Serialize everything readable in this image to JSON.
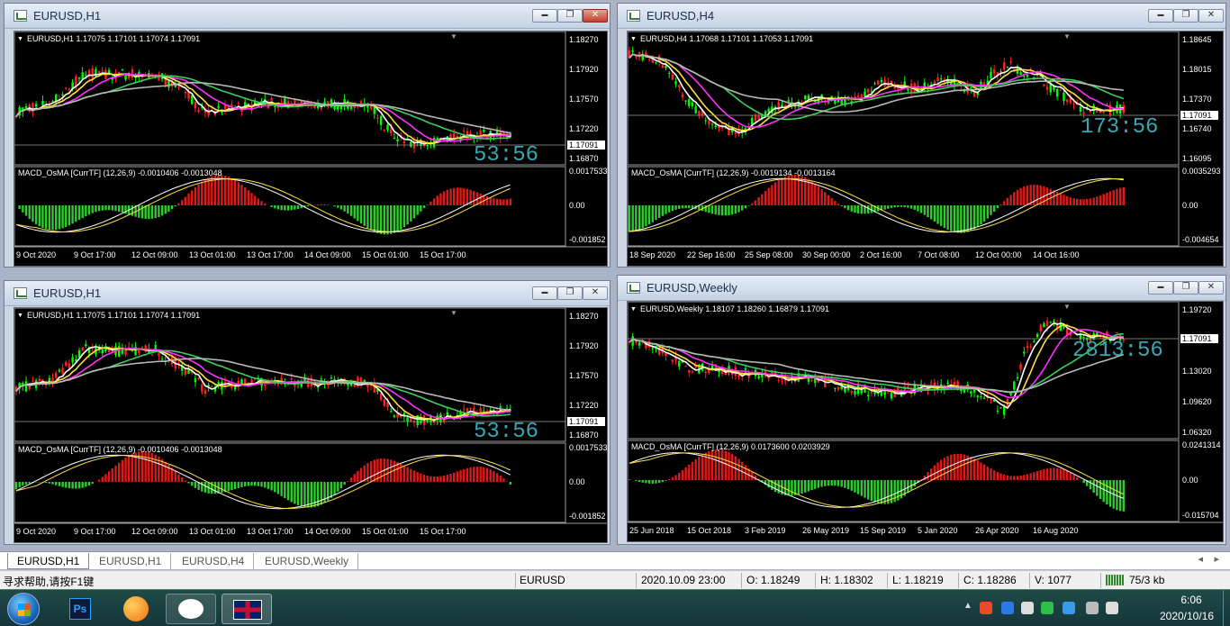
{
  "windows": [
    {
      "id": "w1",
      "title": "EURUSD,H1",
      "header": "EURUSD,H1  1.17075 1.17101 1.17074 1.17091",
      "price_labels": [
        "1.18270",
        "1.17920",
        "1.17570",
        "1.17220",
        "1.16870"
      ],
      "price_box": "1.17091",
      "timer": "53:56",
      "osc_header": "MACD_OsMA [CurrTF] (12,26,9) -0.0010406 -0.0013048",
      "osc_labels": [
        "0.0017533",
        "0.00",
        "-0.001852"
      ],
      "time_labels": [
        "9 Oct 2020",
        "9 Oct 17:00",
        "12 Oct 09:00",
        "13 Oct 01:00",
        "13 Oct 17:00",
        "14 Oct 09:00",
        "15 Oct 01:00",
        "15 Oct 17:00"
      ]
    },
    {
      "id": "w2",
      "title": "EURUSD,H4",
      "header": "EURUSD,H4  1.17068 1.17101 1.17053 1.17091",
      "price_labels": [
        "1.18645",
        "1.18015",
        "1.17370",
        "1.16740",
        "1.16095"
      ],
      "price_box": "1.17091",
      "timer": "173:56",
      "osc_header": "MACD_OsMA [CurrTF] (12,26,9) -0.0019134 -0.0013164",
      "osc_labels": [
        "0.0035293",
        "0.00",
        "-0.004654"
      ],
      "time_labels": [
        "18 Sep 2020",
        "22 Sep 16:00",
        "25 Sep 08:00",
        "30 Sep 00:00",
        "2 Oct 16:00",
        "7 Oct 08:00",
        "12 Oct 00:00",
        "14 Oct 16:00"
      ]
    },
    {
      "id": "w3",
      "title": "EURUSD,H1",
      "header": "EURUSD,H1  1.17075 1.17101 1.17074 1.17091",
      "price_labels": [
        "1.18270",
        "1.17920",
        "1.17570",
        "1.17220",
        "1.16870"
      ],
      "price_box": "1.17091",
      "timer": "53:56",
      "osc_header": "MACD_OsMA [CurrTF] (12,26,9) -0.0010406 -0.0013048",
      "osc_labels": [
        "0.0017533",
        "0.00",
        "-0.001852"
      ],
      "time_labels": [
        "9 Oct 2020",
        "9 Oct 17:00",
        "12 Oct 09:00",
        "13 Oct 01:00",
        "13 Oct 17:00",
        "14 Oct 09:00",
        "15 Oct 01:00",
        "15 Oct 17:00"
      ]
    },
    {
      "id": "w4",
      "title": "EURUSD,Weekly",
      "header": "EURUSD,Weekly  1.18107 1.18260 1.16879 1.17091",
      "price_labels": [
        "1.19720",
        "1.16320",
        "1.13020",
        "1.09620",
        "1.06320"
      ],
      "price_box": "1.17091",
      "timer": "2813:56",
      "osc_header": "MACD_OsMA [CurrTF] (12,26,9) 0.0173600 0.0203929",
      "osc_labels": [
        "0.0241314",
        "0.00",
        "-0.015704"
      ],
      "time_labels": [
        "25 Jun 2018",
        "15 Oct 2018",
        "3 Feb 2019",
        "26 May 2019",
        "15 Sep 2019",
        "5 Jan 2020",
        "26 Apr 2020",
        "16 Aug 2020"
      ]
    }
  ],
  "tabs": [
    "EURUSD,H1",
    "EURUSD,H1",
    "EURUSD,H4",
    "EURUSD,Weekly"
  ],
  "status": {
    "help": "寻求帮助,请按F1键",
    "symbol": "EURUSD",
    "datetime": "2020.10.09 23:00",
    "open": "O: 1.18249",
    "high": "H: 1.18302",
    "low": "L: 1.18219",
    "close": "C: 1.18286",
    "volume": "V: 1077",
    "traffic": "75/3 kb"
  },
  "taskbar": {
    "time": "6:06",
    "date": "2020/10/16",
    "apps": [
      "start-orb",
      "photoshop",
      "browser",
      "wechat",
      "metatrader"
    ],
    "ps_label": "Ps"
  }
}
